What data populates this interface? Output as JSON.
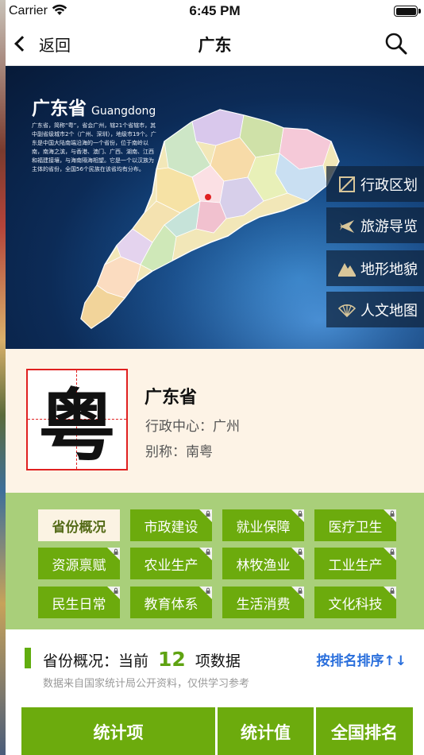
{
  "status_bar": {
    "carrier": "Carrier",
    "time": "6:45 PM"
  },
  "nav": {
    "back_label": "返回",
    "title": "广东"
  },
  "map": {
    "title": "广东省",
    "title_en": "Guangdong",
    "description": "广东省，简称“粤”，省会广州，辖21个省辖市，其中副省级城市2个（广州、深圳），地级市19个。广东是中国大陆南端沿海的一个省份，位于南岭以南，南海之滨，与香港、澳门、广西、湖南、江西和福建接壤，与海南隔海相望。它是一个以汉族为主体的省份，全国56个民族在该省均有分布。",
    "side_buttons": [
      {
        "label": "行政区划",
        "icon": "map-frame-icon"
      },
      {
        "label": "旅游导览",
        "icon": "airplane-icon"
      },
      {
        "label": "地形地貌",
        "icon": "mountain-icon"
      },
      {
        "label": "人文地图",
        "icon": "fan-icon"
      }
    ]
  },
  "province": {
    "seal_char": "粤",
    "name": "广东省",
    "center": "行政中心：广州",
    "alias": "别称：南粤"
  },
  "categories": [
    {
      "label": "省份概况",
      "active": true,
      "locked": false
    },
    {
      "label": "市政建设",
      "active": false,
      "locked": true
    },
    {
      "label": "就业保障",
      "active": false,
      "locked": true
    },
    {
      "label": "医疗卫生",
      "active": false,
      "locked": true
    },
    {
      "label": "资源禀赋",
      "active": false,
      "locked": true
    },
    {
      "label": "农业生产",
      "active": false,
      "locked": true
    },
    {
      "label": "林牧渔业",
      "active": false,
      "locked": true
    },
    {
      "label": "工业生产",
      "active": false,
      "locked": true
    },
    {
      "label": "民生日常",
      "active": false,
      "locked": true
    },
    {
      "label": "教育体系",
      "active": false,
      "locked": true
    },
    {
      "label": "生活消费",
      "active": false,
      "locked": true
    },
    {
      "label": "文化科技",
      "active": false,
      "locked": true
    }
  ],
  "stats": {
    "title_prefix": "省份概况：当前",
    "count": "12",
    "title_suffix": "项数据",
    "sort_label": "按排名排序↑↓",
    "note": "数据来自国家统计局公开资料，仅供学习参考",
    "columns": [
      "统计项",
      "统计值",
      "全国排名"
    ]
  },
  "colors": {
    "accent_green": "#6cab0d",
    "panel_green": "#a9cf7a",
    "link_blue": "#2a6fdc",
    "seal_red": "#e02020",
    "cream": "#fdf3e6"
  }
}
